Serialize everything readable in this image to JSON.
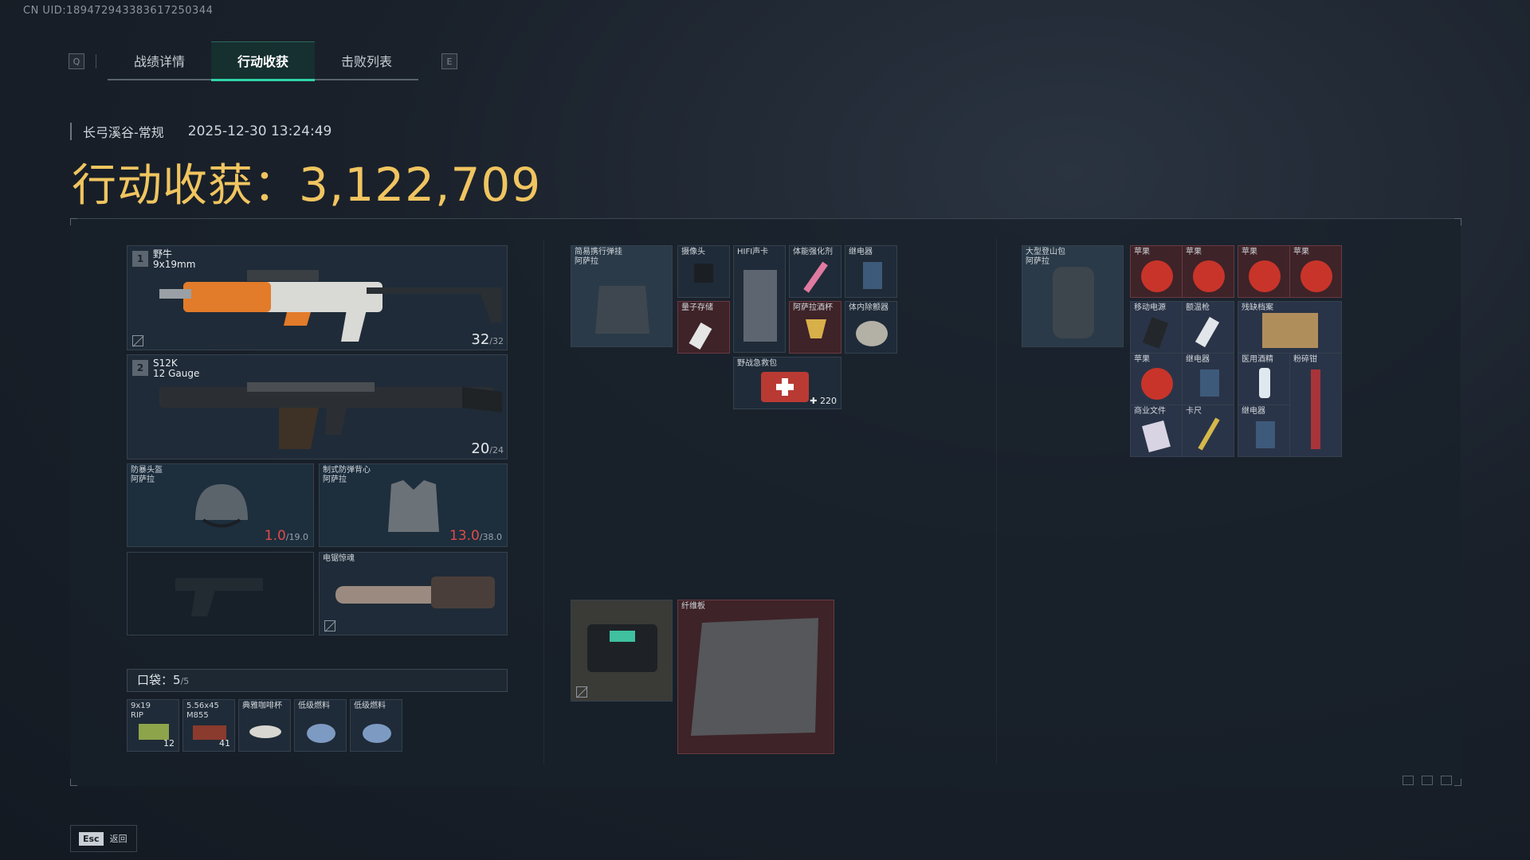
{
  "uid": "CN UID:1894729433836172503​44",
  "tabs": {
    "key_left": "Q",
    "key_right": "E",
    "items": [
      "战绩详情",
      "行动收获",
      "击败列表"
    ],
    "active": "行动收获"
  },
  "session": {
    "map": "长弓溪谷-常规",
    "timestamp": "2025-12-30 13:24:49"
  },
  "total": {
    "label": "行动收获：",
    "value": "3,122,709"
  },
  "loadout": {
    "weapon1": {
      "index": "1",
      "name": "野牛",
      "ammo_type": "9x19mm",
      "ammo": "32",
      "ammo_max": "/32"
    },
    "weapon2": {
      "index": "2",
      "name": "S12K",
      "ammo_type": "12 Gauge",
      "ammo": "20",
      "ammo_max": "/24"
    },
    "helmet": {
      "name": "防暴头盔\n阿萨拉",
      "durability": "1.0",
      "durability_max": "/19.0"
    },
    "armor": {
      "name": "制式防弹背心\n阿萨拉",
      "durability": "13.0",
      "durability_max": "/38.0"
    },
    "melee": {
      "name": "电锯惊魂"
    }
  },
  "pocket": {
    "label": "口袋：",
    "count": "5",
    "capacity": "/5",
    "items": [
      {
        "name": "9x19\nRIP",
        "count": "12"
      },
      {
        "name": "5.56x45\nM855",
        "count": "41"
      },
      {
        "name": "典雅咖啡杯",
        "count": ""
      },
      {
        "name": "低级燃料",
        "count": ""
      },
      {
        "name": "低级燃料",
        "count": ""
      }
    ]
  },
  "rig": {
    "name": "简易携行弹挂\n阿萨拉",
    "items": [
      {
        "name": "摄像头"
      },
      {
        "name": "HIFI声卡"
      },
      {
        "name": "体能强化剂"
      },
      {
        "name": "继电器"
      },
      {
        "name": "量子存储"
      },
      {
        "name": "阿萨拉酒杯"
      },
      {
        "name": "体内除颤器"
      },
      {
        "name": "野战急救包",
        "count": "220"
      }
    ]
  },
  "secure": {
    "items": [
      {
        "name": ""
      },
      {
        "name": "纤维板"
      }
    ]
  },
  "backpack": {
    "name": "大型登山包\n阿萨拉",
    "items": [
      {
        "name": "苹果"
      },
      {
        "name": "苹果"
      },
      {
        "name": "苹果"
      },
      {
        "name": "苹果"
      },
      {
        "name": "移动电源"
      },
      {
        "name": "额温枪"
      },
      {
        "name": "残缺档案"
      },
      {
        "name": "苹果"
      },
      {
        "name": "继电器"
      },
      {
        "name": "医用酒精"
      },
      {
        "name": "粉碎钳"
      },
      {
        "name": "商业文件"
      },
      {
        "name": "卡尺"
      },
      {
        "name": "继电器"
      }
    ]
  },
  "footer": {
    "esc_key": "Esc",
    "back": "返回"
  },
  "colors": {
    "accent": "#2fd4a8",
    "gold": "#f0c560",
    "damage": "#e04a4a",
    "rare_bg": "#3e2328"
  }
}
